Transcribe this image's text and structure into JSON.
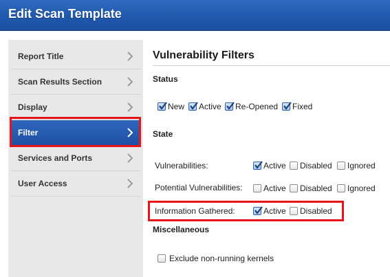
{
  "window": {
    "title": "Edit Scan Template"
  },
  "sidebar": {
    "items": [
      {
        "label": "Report Title",
        "active": false
      },
      {
        "label": "Scan Results Section",
        "active": false
      },
      {
        "label": "Display",
        "active": false
      },
      {
        "label": "Filter",
        "active": true
      },
      {
        "label": "Services and Ports",
        "active": false
      },
      {
        "label": "User Access",
        "active": false
      }
    ]
  },
  "main": {
    "heading": "Vulnerability Filters",
    "status": {
      "label": "Status",
      "options": [
        {
          "label": "New",
          "checked": true
        },
        {
          "label": "Active",
          "checked": true
        },
        {
          "label": "Re-Opened",
          "checked": true
        },
        {
          "label": "Fixed",
          "checked": true
        }
      ]
    },
    "state": {
      "label": "State",
      "rows": [
        {
          "label": "Vulnerabilities:",
          "options": [
            {
              "label": "Active",
              "checked": true
            },
            {
              "label": "Disabled",
              "checked": false
            },
            {
              "label": "Ignored",
              "checked": false
            }
          ]
        },
        {
          "label": "Potential Vulnerabilities:",
          "options": [
            {
              "label": "Active",
              "checked": false
            },
            {
              "label": "Disabled",
              "checked": false
            },
            {
              "label": "Ignored",
              "checked": false
            }
          ]
        },
        {
          "label": "Information Gathered:",
          "options": [
            {
              "label": "Active",
              "checked": true
            },
            {
              "label": "Disabled",
              "checked": false
            }
          ]
        }
      ]
    },
    "misc": {
      "label": "Miscellaneous",
      "options": [
        {
          "label": "Exclude non-running kernels",
          "checked": false
        }
      ]
    }
  },
  "colors": {
    "titlebar": "#1f58ad",
    "nav_active": "#1e4fa3",
    "highlight": "#e8141c"
  },
  "icons": [
    "chevron-right-icon",
    "checkmark-icon"
  ]
}
